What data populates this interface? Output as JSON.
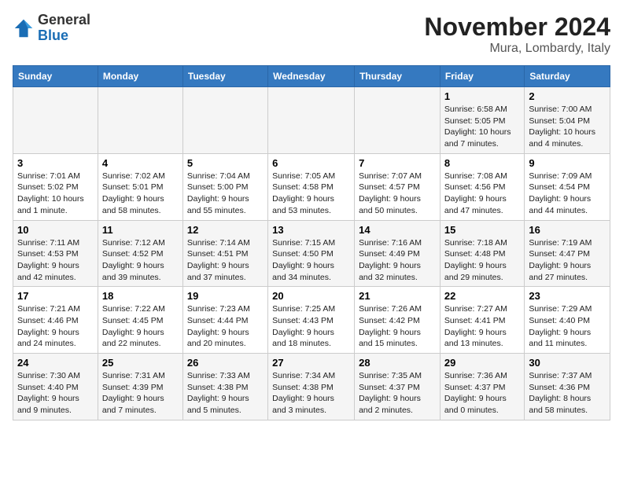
{
  "logo": {
    "general": "General",
    "blue": "Blue"
  },
  "title": "November 2024",
  "location": "Mura, Lombardy, Italy",
  "weekdays": [
    "Sunday",
    "Monday",
    "Tuesday",
    "Wednesday",
    "Thursday",
    "Friday",
    "Saturday"
  ],
  "weeks": [
    [
      {
        "day": "",
        "info": ""
      },
      {
        "day": "",
        "info": ""
      },
      {
        "day": "",
        "info": ""
      },
      {
        "day": "",
        "info": ""
      },
      {
        "day": "",
        "info": ""
      },
      {
        "day": "1",
        "info": "Sunrise: 6:58 AM\nSunset: 5:05 PM\nDaylight: 10 hours and 7 minutes."
      },
      {
        "day": "2",
        "info": "Sunrise: 7:00 AM\nSunset: 5:04 PM\nDaylight: 10 hours and 4 minutes."
      }
    ],
    [
      {
        "day": "3",
        "info": "Sunrise: 7:01 AM\nSunset: 5:02 PM\nDaylight: 10 hours and 1 minute."
      },
      {
        "day": "4",
        "info": "Sunrise: 7:02 AM\nSunset: 5:01 PM\nDaylight: 9 hours and 58 minutes."
      },
      {
        "day": "5",
        "info": "Sunrise: 7:04 AM\nSunset: 5:00 PM\nDaylight: 9 hours and 55 minutes."
      },
      {
        "day": "6",
        "info": "Sunrise: 7:05 AM\nSunset: 4:58 PM\nDaylight: 9 hours and 53 minutes."
      },
      {
        "day": "7",
        "info": "Sunrise: 7:07 AM\nSunset: 4:57 PM\nDaylight: 9 hours and 50 minutes."
      },
      {
        "day": "8",
        "info": "Sunrise: 7:08 AM\nSunset: 4:56 PM\nDaylight: 9 hours and 47 minutes."
      },
      {
        "day": "9",
        "info": "Sunrise: 7:09 AM\nSunset: 4:54 PM\nDaylight: 9 hours and 44 minutes."
      }
    ],
    [
      {
        "day": "10",
        "info": "Sunrise: 7:11 AM\nSunset: 4:53 PM\nDaylight: 9 hours and 42 minutes."
      },
      {
        "day": "11",
        "info": "Sunrise: 7:12 AM\nSunset: 4:52 PM\nDaylight: 9 hours and 39 minutes."
      },
      {
        "day": "12",
        "info": "Sunrise: 7:14 AM\nSunset: 4:51 PM\nDaylight: 9 hours and 37 minutes."
      },
      {
        "day": "13",
        "info": "Sunrise: 7:15 AM\nSunset: 4:50 PM\nDaylight: 9 hours and 34 minutes."
      },
      {
        "day": "14",
        "info": "Sunrise: 7:16 AM\nSunset: 4:49 PM\nDaylight: 9 hours and 32 minutes."
      },
      {
        "day": "15",
        "info": "Sunrise: 7:18 AM\nSunset: 4:48 PM\nDaylight: 9 hours and 29 minutes."
      },
      {
        "day": "16",
        "info": "Sunrise: 7:19 AM\nSunset: 4:47 PM\nDaylight: 9 hours and 27 minutes."
      }
    ],
    [
      {
        "day": "17",
        "info": "Sunrise: 7:21 AM\nSunset: 4:46 PM\nDaylight: 9 hours and 24 minutes."
      },
      {
        "day": "18",
        "info": "Sunrise: 7:22 AM\nSunset: 4:45 PM\nDaylight: 9 hours and 22 minutes."
      },
      {
        "day": "19",
        "info": "Sunrise: 7:23 AM\nSunset: 4:44 PM\nDaylight: 9 hours and 20 minutes."
      },
      {
        "day": "20",
        "info": "Sunrise: 7:25 AM\nSunset: 4:43 PM\nDaylight: 9 hours and 18 minutes."
      },
      {
        "day": "21",
        "info": "Sunrise: 7:26 AM\nSunset: 4:42 PM\nDaylight: 9 hours and 15 minutes."
      },
      {
        "day": "22",
        "info": "Sunrise: 7:27 AM\nSunset: 4:41 PM\nDaylight: 9 hours and 13 minutes."
      },
      {
        "day": "23",
        "info": "Sunrise: 7:29 AM\nSunset: 4:40 PM\nDaylight: 9 hours and 11 minutes."
      }
    ],
    [
      {
        "day": "24",
        "info": "Sunrise: 7:30 AM\nSunset: 4:40 PM\nDaylight: 9 hours and 9 minutes."
      },
      {
        "day": "25",
        "info": "Sunrise: 7:31 AM\nSunset: 4:39 PM\nDaylight: 9 hours and 7 minutes."
      },
      {
        "day": "26",
        "info": "Sunrise: 7:33 AM\nSunset: 4:38 PM\nDaylight: 9 hours and 5 minutes."
      },
      {
        "day": "27",
        "info": "Sunrise: 7:34 AM\nSunset: 4:38 PM\nDaylight: 9 hours and 3 minutes."
      },
      {
        "day": "28",
        "info": "Sunrise: 7:35 AM\nSunset: 4:37 PM\nDaylight: 9 hours and 2 minutes."
      },
      {
        "day": "29",
        "info": "Sunrise: 7:36 AM\nSunset: 4:37 PM\nDaylight: 9 hours and 0 minutes."
      },
      {
        "day": "30",
        "info": "Sunrise: 7:37 AM\nSunset: 4:36 PM\nDaylight: 8 hours and 58 minutes."
      }
    ]
  ]
}
